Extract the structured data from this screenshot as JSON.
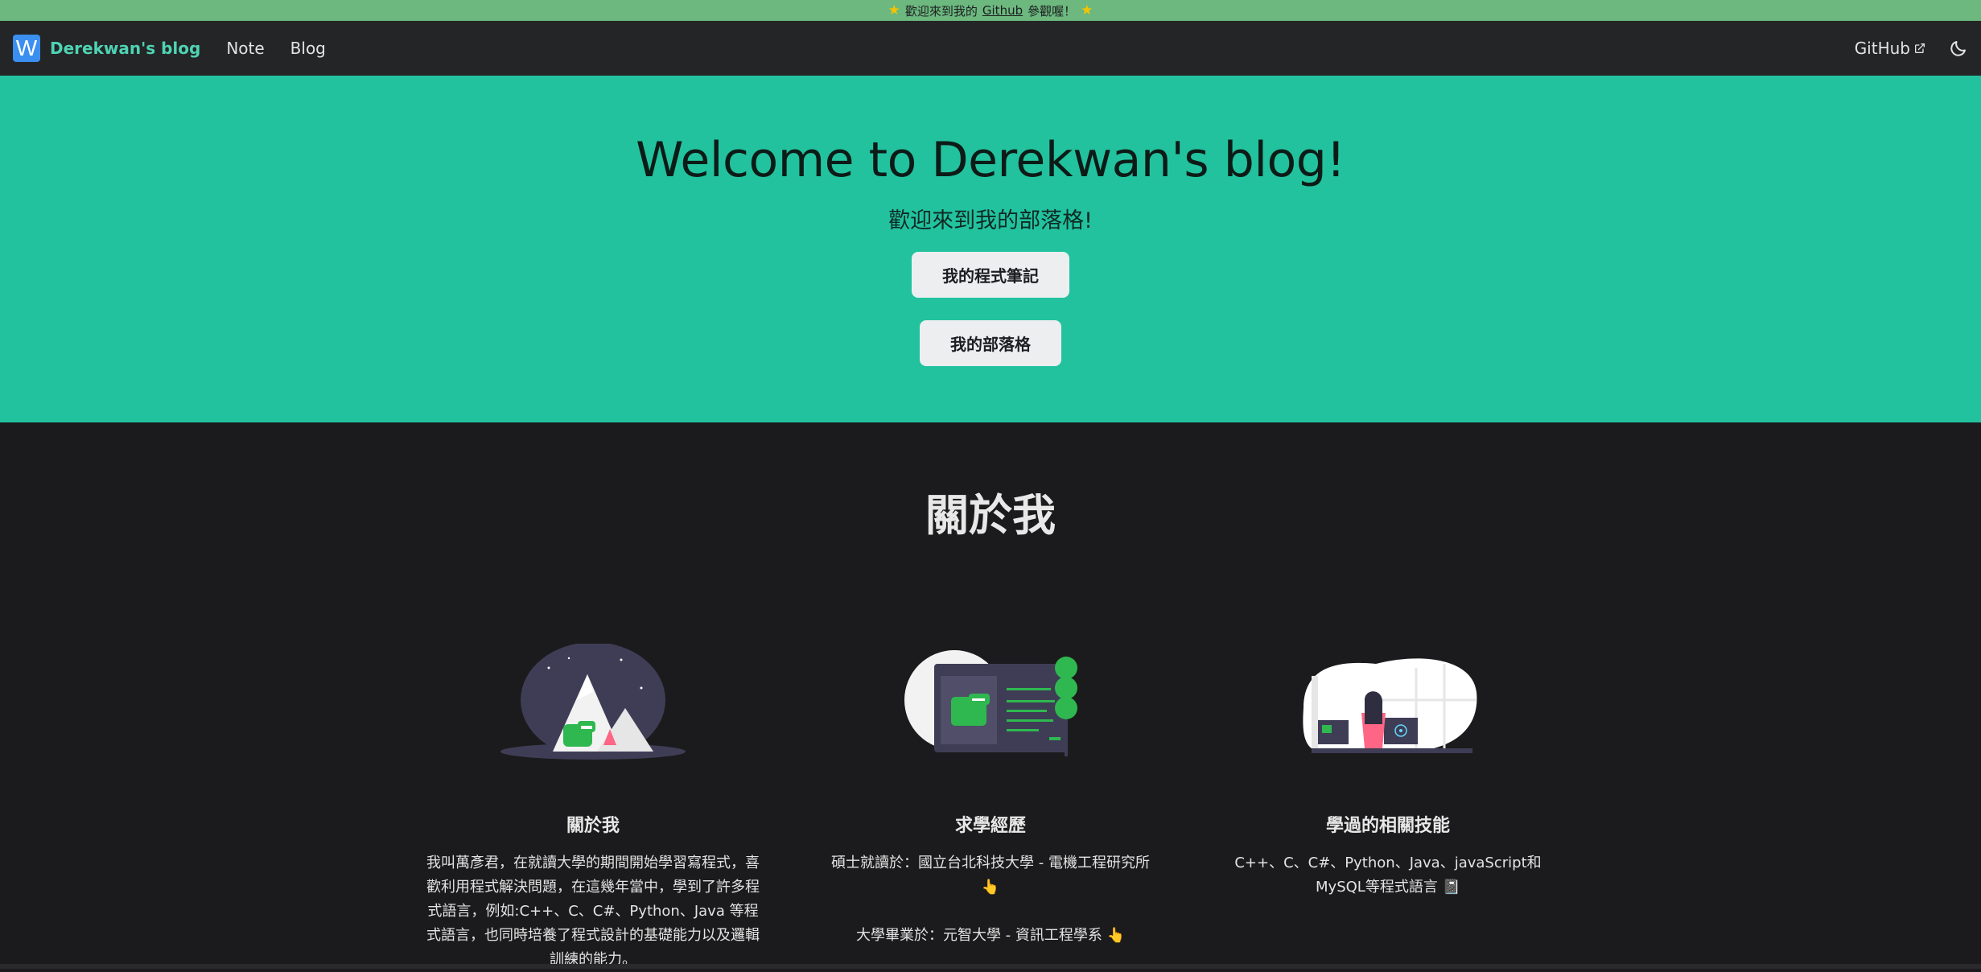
{
  "announcement": {
    "prefix": "歡迎來到我的",
    "link": "Github",
    "suffix": "參觀喔！"
  },
  "navbar": {
    "logo_letter": "W",
    "brand": "Derekwan's blog",
    "links": [
      "Note",
      "Blog"
    ],
    "github": "GitHub"
  },
  "hero": {
    "title": "Welcome to Derekwan's blog!",
    "subtitle": "歡迎來到我的部落格!",
    "buttons": [
      "我的程式筆記",
      "我的部落格"
    ]
  },
  "about": {
    "title": "關於我",
    "features": [
      {
        "title": "關於我",
        "text": "我叫萬彥君，在就讀大學的期間開始學習寫程式，喜歡利用程式解決問題，在這幾年當中，學到了許多程式語言，例如:C++、C、C#、Python、Java 等程式語言，也同時培養了程式設計的基礎能力以及邏輯訓練的能力。"
      },
      {
        "title": "求學經歷",
        "text1": "碩士就讀於：國立台北科技大學 - 電機工程研究所 👆",
        "text2": "大學畢業於：元智大學 - 資訊工程學系 👆"
      },
      {
        "title": "學過的相關技能",
        "text": "C++、C、C#、Python、Java、javaScript和MySQL等程式語言 📓"
      }
    ]
  },
  "colors": {
    "hero_bg": "#22c29f",
    "nav_bg": "#242526",
    "page_bg": "#1b1b1d",
    "announce_bg": "#6cb87e",
    "brand": "#4fd3b3"
  },
  "icons": [
    "star-icon",
    "external-link-icon",
    "moon-icon"
  ]
}
